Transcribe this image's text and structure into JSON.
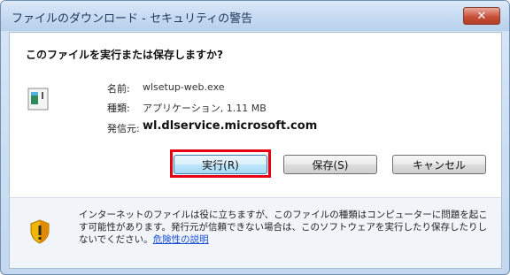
{
  "dialog": {
    "title": "ファイルのダウンロード - セキュリティの警告",
    "close_label": "✕",
    "question": "このファイルを実行または保存しますか?"
  },
  "file": {
    "name_label": "名前:",
    "name_value": "wlsetup-web.exe",
    "type_label": "種類:",
    "type_value": "アプリケーション, 1.11 MB",
    "source_label": "発信元:",
    "source_value": "wl.dlservice.microsoft.com"
  },
  "buttons": {
    "run": "実行(R)",
    "save": "保存(S)",
    "cancel": "キャンセル"
  },
  "warning": {
    "text": "インターネットのファイルは役に立ちますが、このファイルの種類はコンピューターに問題を起こす可能性があります。発行元が信頼できない場合は、このソフトウェアを実行したり保存したりしないでください。",
    "link": "危険性の説明"
  },
  "colors": {
    "highlight": "#e60012",
    "close_button": "#c8523d",
    "link": "#1a4fd6"
  }
}
